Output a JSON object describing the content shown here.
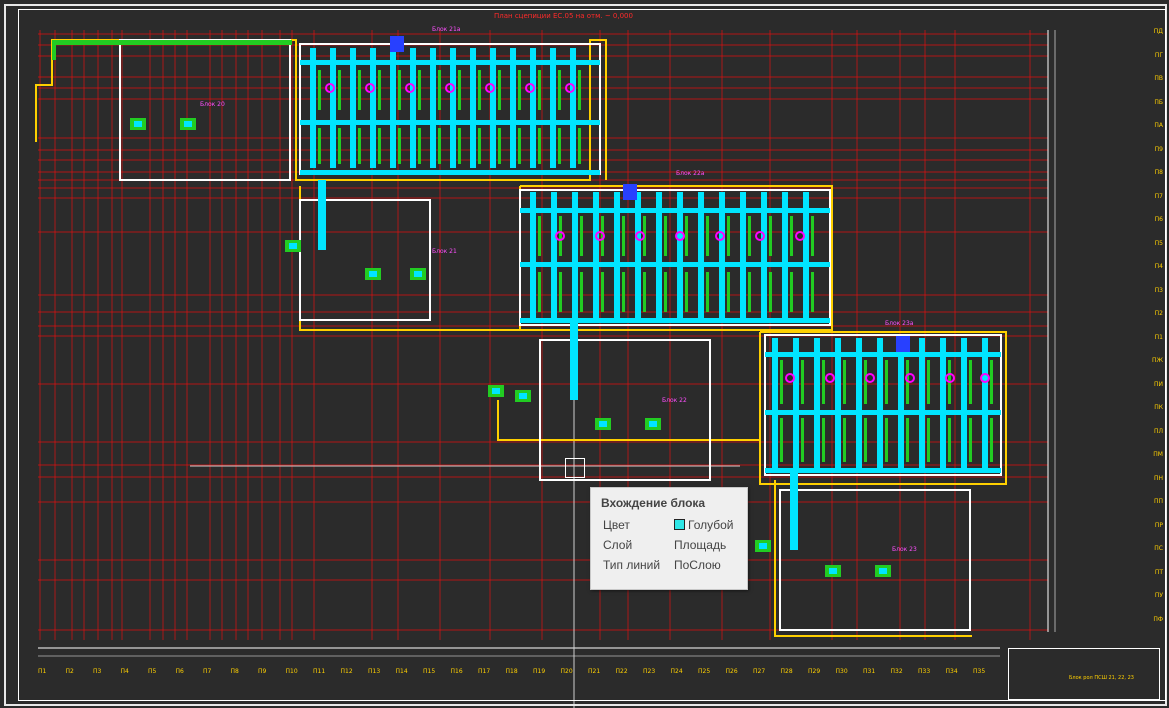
{
  "drawing": {
    "plan_title": "План сцепиции ЕС.05 на отм. ~ 0,000",
    "block_labels": [
      "Блок 21а",
      "Блок 22а",
      "Блок 23а",
      "Блок 20",
      "Блок 21",
      "Блок 22",
      "Блок 23"
    ],
    "column_labels": [
      "П1",
      "П2",
      "П3",
      "П4",
      "П5",
      "П6",
      "П7",
      "П8",
      "П9",
      "П10",
      "П11",
      "П12",
      "П13",
      "П14",
      "П15",
      "П16",
      "П17",
      "П18",
      "П19",
      "П20",
      "П21",
      "П22",
      "П23",
      "П24",
      "П25",
      "П26",
      "П27",
      "П28",
      "П29",
      "П30",
      "П31",
      "П32",
      "П33",
      "П34",
      "П35"
    ],
    "row_labels": [
      "ПД",
      "ПГ",
      "ПВ",
      "ПБ",
      "ПА",
      "П9",
      "П8",
      "П7",
      "П6",
      "П5",
      "П4",
      "П3",
      "П2",
      "П1",
      "ПЖ",
      "ПИ",
      "ПК",
      "ПЛ",
      "ПМ",
      "ПН",
      "ПП",
      "ПР",
      "ПС",
      "ПТ",
      "ПУ",
      "ПФ"
    ],
    "title_block_text": "Блок рол ПСШ 21, 22, 23"
  },
  "tooltip": {
    "title": "Вхождение блока",
    "rows": [
      {
        "label": "Цвет",
        "value": "Голубой",
        "swatch": "#2ee6e6"
      },
      {
        "label": "Слой",
        "value": "Площадь"
      },
      {
        "label": "Тип линий",
        "value": "ПоСлою"
      }
    ]
  },
  "colors": {
    "background": "#2b2b2b",
    "grid": "#e01010",
    "walls": "#ffffff",
    "cyan": "#00e5ff",
    "green": "#22cc22",
    "magenta": "#ff00ff",
    "yellow": "#ffd000"
  }
}
